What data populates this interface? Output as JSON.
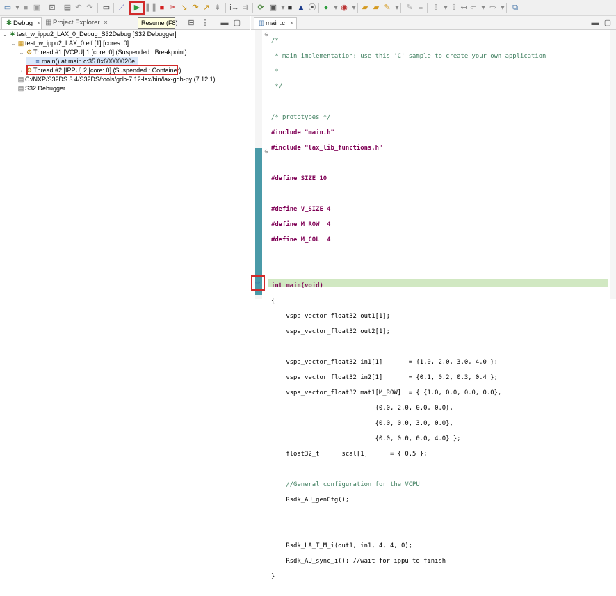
{
  "toolbar": {
    "tooltip": "Resume (F8)",
    "icons": [
      "new",
      "save",
      "save-all",
      "console",
      "build",
      "undo",
      "redo",
      "terminal",
      "skip",
      "resume",
      "suspend",
      "terminate",
      "disconnect",
      "step-into",
      "step-over",
      "step-return",
      "drop-frame",
      "instruction-step",
      "use-step-filters",
      "run-to-line",
      "debug",
      "stop",
      "warning",
      "breakpoints",
      "run",
      "run-dropdown",
      "external-tools",
      "open-folder",
      "open-type",
      "search",
      "marker",
      "annotation",
      "back",
      "forward",
      "new-window"
    ]
  },
  "left_panel": {
    "tabs": [
      {
        "label": "Debug",
        "close": "×"
      },
      {
        "label": "Project Explorer",
        "close": "×"
      }
    ],
    "tree": [
      {
        "label": "test_w_ippu2_LAX_0_Debug_S32Debug [S32 Debugger]"
      },
      {
        "label": "test_w_ippu2_LAX_0.elf [1] [cores: 0]"
      },
      {
        "label": "Thread #1 [VCPU] 1 [core: 0] (Suspended : Breakpoint)"
      },
      {
        "label": "main() at main.c:35 0x60000020e"
      },
      {
        "label": "Thread #2 [IPPU] 2 [core: 0] (Suspended : Container)"
      },
      {
        "label": "C:/NXP/S32DS.3.4/S32DS/tools/gdb-7.12-lax/bin/lax-gdb-py (7.12.1)"
      },
      {
        "label": "S32 Debugger"
      }
    ]
  },
  "editor": {
    "tab": {
      "label": "main.c",
      "close": "×"
    },
    "lines": [
      "/*",
      " * main implementation: use this 'C' sample to create your own application",
      " *",
      " */",
      "",
      "/* prototypes */",
      "#include \"main.h\"",
      "#include \"lax_lib_functions.h\"",
      "",
      "#define SIZE 10",
      "",
      "#define V_SIZE 4",
      "#define M_ROW  4",
      "#define M_COL  4",
      "",
      "",
      "int main(void)",
      "{",
      "    vspa_vector_float32 out1[1];",
      "    vspa_vector_float32 out2[1];",
      "",
      "    vspa_vector_float32 in1[1]       = {1.0, 2.0, 3.0, 4.0 };",
      "    vspa_vector_float32 in2[1]       = {0.1, 0.2, 0.3, 0.4 };",
      "    vspa_vector_float32 mat1[M_ROW]  = { {1.0, 0.0, 0.0, 0.0},",
      "                            {0.0, 2.0, 0.0, 0.0},",
      "                            {0.0, 0.0, 3.0, 0.0},",
      "                            {0.0, 0.0, 0.0, 4.0} };",
      "    float32_t      scal[1]      = { 0.5 };",
      "",
      "    //General configuration for the VCPU",
      "    Rsdk_AU_genCfg();",
      "",
      "",
      "    Rsdk_LA_T_M_i(out1, in1, 4, 4, 0);",
      "    Rsdk_AU_sync_i(); //wait for ippu to finish",
      "}"
    ]
  }
}
